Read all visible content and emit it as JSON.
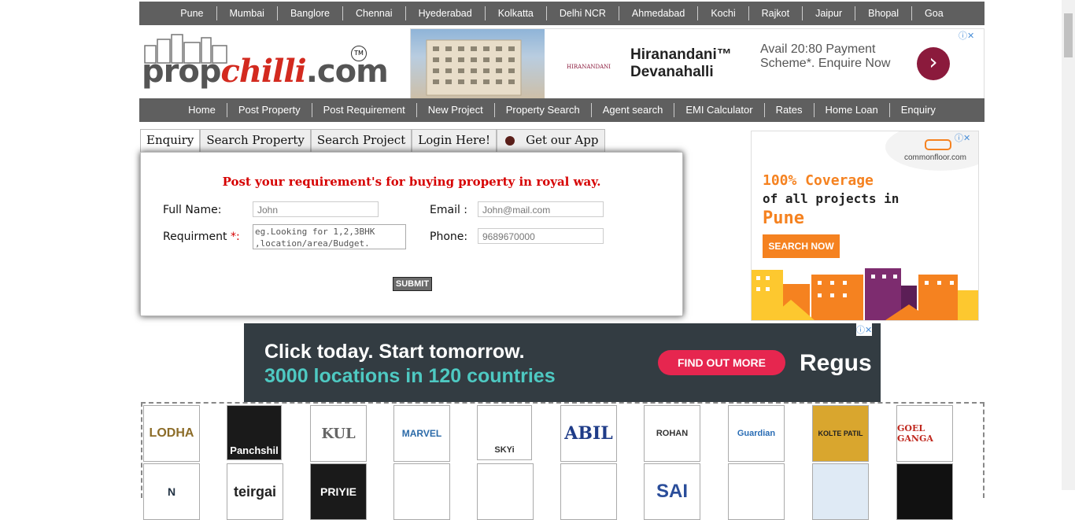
{
  "cities": [
    "Pune",
    "Mumbai",
    "Banglore",
    "Chennai",
    "Hyederabad",
    "Kolkatta",
    "Delhi NCR",
    "Ahmedabad",
    "Kochi",
    "Rajkot",
    "Jaipur",
    "Bhopal",
    "Goa"
  ],
  "logo": {
    "prefix": "prop",
    "accent": "chilli",
    "suffix": ".com",
    "tm": "TM"
  },
  "top_ad": {
    "brand": "HIRANANDANI",
    "title_line1": "Hiranandani™",
    "title_line2": "Devanahalli",
    "offer": "Avail 20:80 Payment Scheme*. Enquire Now",
    "arrow": "›",
    "accent": "#8b1a3c"
  },
  "nav": [
    "Home",
    "Post Property",
    "Post Requirement",
    "New Project",
    "Property Search",
    "Agent search",
    "EMI Calculator",
    "Rates",
    "Home Loan",
    "Enquiry"
  ],
  "tabs": [
    "Enquiry",
    "Search Property",
    "Search Project",
    "Login Here!",
    "Get our App"
  ],
  "form": {
    "title": "Post your requirement's for buying property in royal way.",
    "name_label": "Full Name:",
    "name_placeholder": "John",
    "email_label": "Email :",
    "email_placeholder": "John@mail.com",
    "req_label": "Requirment",
    "req_star": "*:",
    "req_placeholder": "eg.Looking for 1,2,3BHK ,location/area/Budget.",
    "phone_label": "Phone:",
    "phone_placeholder": "9689670000",
    "submit": "SUBMIT"
  },
  "side_ad": {
    "brand": "commonfloor.com",
    "line1": "100% Coverage",
    "line2": "of all projects in",
    "city": "Pune",
    "cta": "SEARCH NOW"
  },
  "regus_ad": {
    "line1": "Click today. Start tomorrow.",
    "line2": "3000 locations in 120 countries",
    "cta": "FIND OUT MORE",
    "brand": "Regus"
  },
  "builders_row1": [
    "LODHA",
    "Panchshil",
    "KUL",
    "MARVEL",
    "SKYi",
    "ABIL",
    "ROHAN",
    "Guardian",
    "KOLTE PATIL",
    "GOEL GANGA"
  ],
  "builders_row2": [
    "N",
    "teirgai",
    "PRIYIE",
    "",
    "",
    "",
    "SAI",
    "",
    "",
    ""
  ]
}
